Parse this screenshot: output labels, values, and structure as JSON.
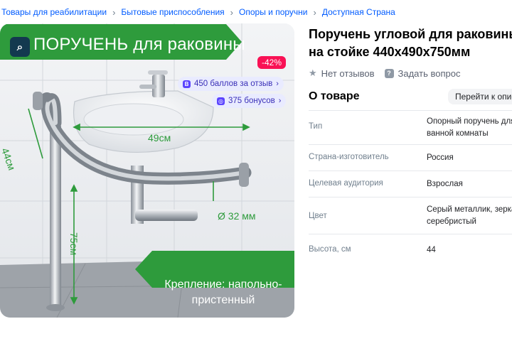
{
  "breadcrumbs": [
    "Товары для реабилитации",
    "Бытовые приспособления",
    "Опоры и поручни",
    "Доступная Страна"
  ],
  "gallery": {
    "brand_title": "ПОРУЧЕНЬ для раковины",
    "logo_icon": "brand-logo-icon",
    "discount": "-42%",
    "bonus_review": "450 баллов за отзыв",
    "bonus_points": "375 бонусов",
    "dim_width": "49см",
    "dim_depth": "44см",
    "dim_height": "75см",
    "dim_diameter": "Ø 32 мм",
    "mount_line1": "Крепление: напольно-",
    "mount_line2": "пристенный",
    "colors": {
      "banner_green": "#2e9b3c",
      "badge_red": "#f91155",
      "pill_bg": "#e9ebff"
    }
  },
  "product": {
    "title_line1": "Поручень угловой для раковины",
    "title_line2": "на стойке 440х490х750мм",
    "no_reviews": "Нет отзывов",
    "ask_question": "Задать вопрос"
  },
  "about": {
    "heading": "О товаре",
    "goto_description": "Перейти к описанию",
    "specs": [
      {
        "label": "Тип",
        "value_lines": [
          "Опорный поручень для",
          "ванной комнаты"
        ]
      },
      {
        "label": "Страна-изготовитель",
        "value_lines": [
          "Россия"
        ]
      },
      {
        "label": "Целевая аудитория",
        "value_lines": [
          "Взрослая"
        ]
      },
      {
        "label": "Цвет",
        "value_lines": [
          "Серый металлик, зеркальный,",
          "серебристый"
        ]
      },
      {
        "label": "Высота, см",
        "value_lines": [
          "44"
        ]
      }
    ]
  },
  "accent_color": "#005bff"
}
